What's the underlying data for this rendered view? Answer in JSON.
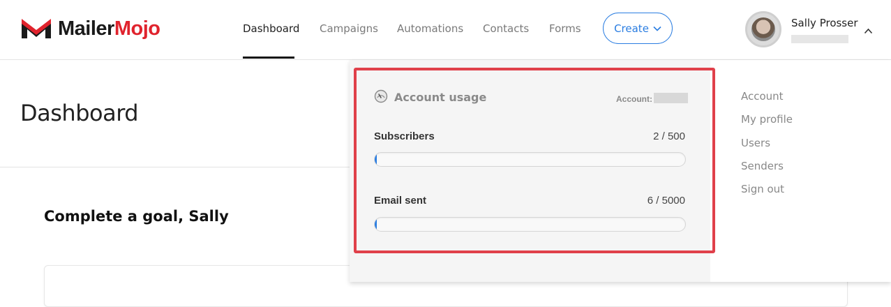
{
  "brand": {
    "name_part1": "Mailer",
    "name_part2": "Mojo",
    "accent_color": "#e0232d"
  },
  "nav": {
    "items": [
      {
        "label": "Dashboard",
        "active": true
      },
      {
        "label": "Campaigns",
        "active": false
      },
      {
        "label": "Automations",
        "active": false
      },
      {
        "label": "Contacts",
        "active": false
      },
      {
        "label": "Forms",
        "active": false
      }
    ],
    "create_label": "Create",
    "create_icon": "chevron-down-icon",
    "accent_color": "#2a7de1"
  },
  "user": {
    "name": "Sally Prosser",
    "menu_icon": "chevron-up-icon"
  },
  "page": {
    "title": "Dashboard",
    "goal_heading": "Complete a goal, Sally"
  },
  "account_usage": {
    "title": "Account usage",
    "icon": "gauge-icon",
    "account_label": "Account:",
    "subscribers": {
      "label": "Subscribers",
      "value_text": "2 / 500",
      "used": 2,
      "limit": 500
    },
    "emails": {
      "label": "Email sent",
      "value_text": "6 / 5000",
      "used": 6,
      "limit": 5000
    }
  },
  "user_menu": {
    "items": [
      {
        "label": "Account"
      },
      {
        "label": "My profile"
      },
      {
        "label": "Users"
      },
      {
        "label": "Senders"
      },
      {
        "label": "Sign out"
      }
    ]
  }
}
